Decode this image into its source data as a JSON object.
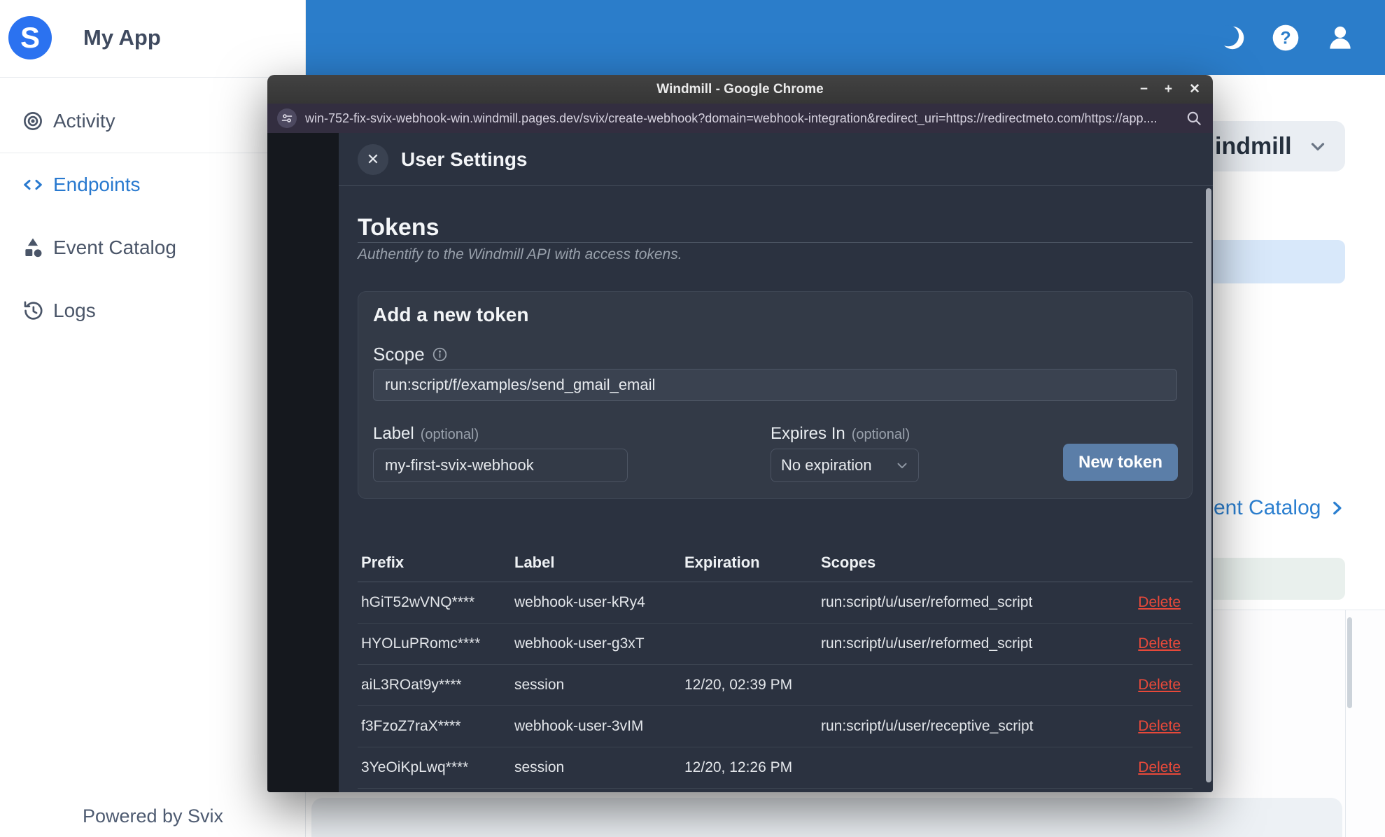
{
  "sidebar": {
    "app_name": "My App",
    "items": [
      {
        "label": "Activity",
        "icon": "activity-target-icon",
        "active": false
      },
      {
        "label": "Endpoints",
        "icon": "code-brackets-icon",
        "active": true
      },
      {
        "label": "Event Catalog",
        "icon": "shapes-icon",
        "active": false
      },
      {
        "label": "Logs",
        "icon": "history-clock-icon",
        "active": false
      }
    ],
    "footer": "Powered by Svix"
  },
  "topbar": {
    "icons": [
      "dark-mode-moon-icon",
      "help-icon",
      "user-icon"
    ],
    "help_glyph": "?"
  },
  "background_page": {
    "workspace_chip_visible_text": "indmill",
    "catalog_link_visible_text": "ent Catalog"
  },
  "chrome": {
    "window_title": "Windmill - Google Chrome",
    "controls": {
      "minimize": "−",
      "maximize": "+",
      "close": "✕"
    },
    "url": "win-752-fix-svix-webhook-win.windmill.pages.dev/svix/create-webhook?domain=webhook-integration&redirect_uri=https://redirectmeto.com/https://app...."
  },
  "modal": {
    "title": "User Settings",
    "close_glyph": "✕",
    "section_title": "Tokens",
    "section_subtitle": "Authentify to the Windmill API with access tokens.",
    "form": {
      "title": "Add a new token",
      "scope_label": "Scope",
      "scope_value": "run:script/f/examples/send_gmail_email",
      "label_label": "Label",
      "optional": "(optional)",
      "label_value": "my-first-svix-webhook",
      "expires_label": "Expires In",
      "expires_value": "No expiration",
      "submit_label": "New token"
    },
    "table": {
      "headers": [
        "Prefix",
        "Label",
        "Expiration",
        "Scopes"
      ],
      "delete_label": "Delete",
      "rows": [
        {
          "prefix": "hGiT52wVNQ****",
          "label": "webhook-user-kRy4",
          "expiration": "",
          "scopes": "run:script/u/user/reformed_script"
        },
        {
          "prefix": "HYOLuPRomc****",
          "label": "webhook-user-g3xT",
          "expiration": "",
          "scopes": "run:script/u/user/reformed_script"
        },
        {
          "prefix": "aiL3ROat9y****",
          "label": "session",
          "expiration": "12/20, 02:39 PM",
          "scopes": ""
        },
        {
          "prefix": "f3FzoZ7raX****",
          "label": "webhook-user-3vIM",
          "expiration": "",
          "scopes": "run:script/u/user/receptive_script"
        },
        {
          "prefix": "3YeOiKpLwq****",
          "label": "session",
          "expiration": "12/20, 12:26 PM",
          "scopes": ""
        }
      ]
    }
  },
  "colors": {
    "header_blue": "#2b7dca",
    "active_link_blue": "#2879cf",
    "catalog_link_blue": "#2b7fd0",
    "logo_blue": "#2b72f0",
    "button_blue": "#5b7ea8",
    "delete_red": "#e8493a",
    "modal_bg": "#2b3240",
    "card_bg": "#333a47",
    "titlebar_gray": "#3b3b3b",
    "urlbar_purple": "#332e40"
  }
}
